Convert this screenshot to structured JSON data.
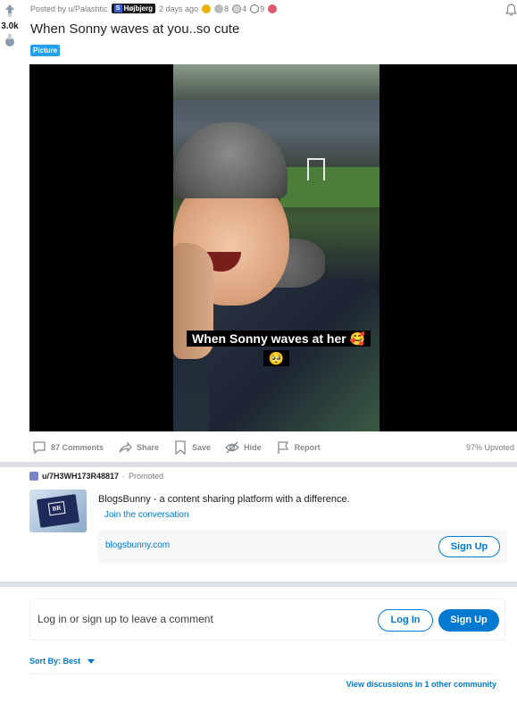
{
  "vote": {
    "score": "3.0k"
  },
  "post": {
    "posted_by": "Posted by u/Palashtic",
    "user_flair": "Højbjerg",
    "time": "2 days ago",
    "awards": [
      {
        "icon": "gold-award-icon",
        "color": "#e8b100",
        "count": ""
      },
      {
        "icon": "helpful-award-icon",
        "color": "#8a8d8f",
        "count": "8"
      },
      {
        "icon": "wholesome-award-icon",
        "color": "#8a8d8f",
        "count": "4"
      },
      {
        "icon": "silver-award-icon",
        "color": "#8a8d8f",
        "count": "9"
      },
      {
        "icon": "heart-award-icon",
        "color": "#e05b6f",
        "count": ""
      }
    ],
    "title": "When Sonny waves at you..so cute",
    "flair": "Picture",
    "media_caption": "When Sonny waves at her 🥰🥺"
  },
  "actions": {
    "comments": "87 Comments",
    "share": "Share",
    "save": "Save",
    "hide": "Hide",
    "report": "Report",
    "upvoted": "97% Upvoted"
  },
  "promoted": {
    "user": "u/7H3WH173R48817",
    "tag": "Promoted",
    "thumb_logo": "BR",
    "text": "BlogsBunny - a content sharing platform with a difference.",
    "link": "Join the conversation",
    "domain": "blogsbunny.com",
    "cta": "Sign Up"
  },
  "comment_login": {
    "text": "Log in or sign up to leave a comment",
    "login": "Log In",
    "signup": "Sign Up"
  },
  "sort": {
    "label": "Sort By: Best"
  },
  "view_discussions": "View discussions in 1 other community",
  "colors": {
    "accent": "#0079d3",
    "divider": "#dae0e6",
    "flair": "#24a0ed"
  }
}
